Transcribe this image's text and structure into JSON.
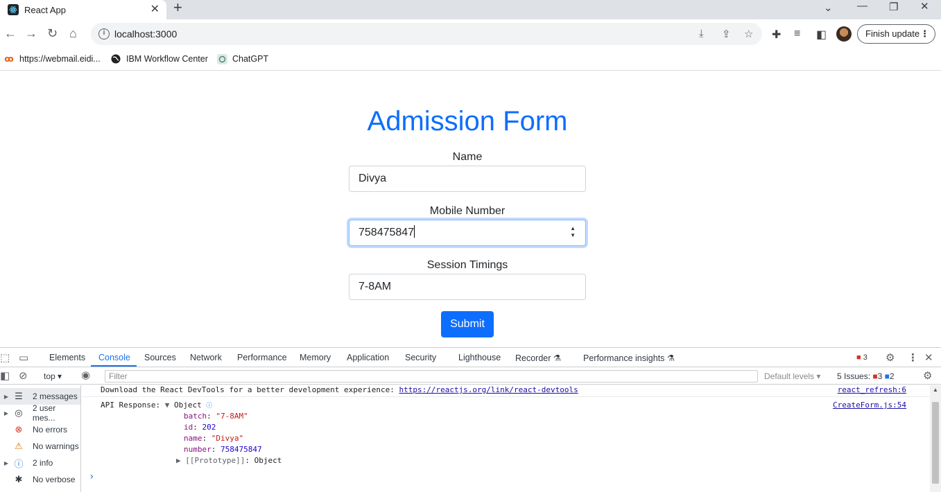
{
  "browser": {
    "tab_title": "React App",
    "new_tab_label": "+",
    "url": "localhost:3000",
    "update_button": "Finish update",
    "bookmarks": [
      "https://webmail.eidi...",
      "IBM Workflow Center",
      "ChatGPT"
    ]
  },
  "form": {
    "title": "Admission Form",
    "name_label": "Name",
    "name_value": "Divya",
    "mobile_label": "Mobile Number",
    "mobile_value": "758475847",
    "session_label": "Session Timings",
    "session_value": "7-8AM",
    "submit_label": "Submit",
    "accent_color": "#0d6efd"
  },
  "devtools": {
    "tabs": [
      "Elements",
      "Console",
      "Sources",
      "Network",
      "Performance",
      "Memory",
      "Application",
      "Security",
      "Lighthouse",
      "Recorder",
      "Performance insights"
    ],
    "active_tab": "Console",
    "error_count": "3",
    "issues_label": "5 Issues:",
    "issues_errors": "3",
    "issues_info": "2",
    "context": "top",
    "filter_placeholder": "Filter",
    "levels": "Default levels",
    "sidebar": [
      {
        "label": "2 messages",
        "icon": "list-icon"
      },
      {
        "label": "2 user mes...",
        "icon": "user-icon"
      },
      {
        "label": "No errors",
        "icon": "error-icon"
      },
      {
        "label": "No warnings",
        "icon": "warning-icon"
      },
      {
        "label": "2 info",
        "icon": "info-icon"
      },
      {
        "label": "No verbose",
        "icon": "bug-icon"
      }
    ],
    "console": {
      "line1_text": "Download the React DevTools for a better development experience: ",
      "line1_link": "https://reactjs.org/link/react-devtools",
      "line1_src": "react_refresh:6",
      "line2_text": "API Response: ",
      "line2_obj": "Object",
      "line2_src": "CreateForm.js:54",
      "props": [
        {
          "key": "batch",
          "value": "\"7-8AM\""
        },
        {
          "key": "id",
          "value": "202"
        },
        {
          "key": "name",
          "value": "\"Divya\""
        },
        {
          "key": "number",
          "value": "758475847"
        }
      ],
      "proto_key": "[[Prototype]]",
      "proto_value": "Object",
      "prompt": "›"
    }
  }
}
